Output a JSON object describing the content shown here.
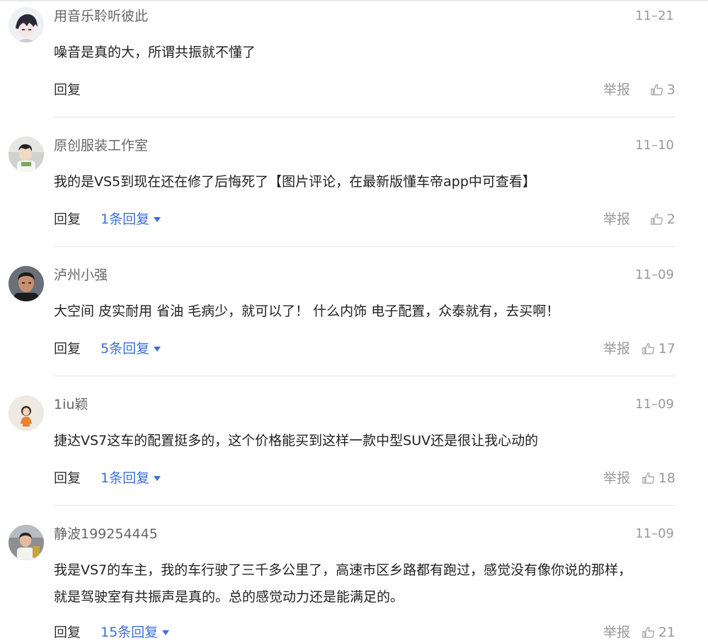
{
  "comments": [
    {
      "username": "用音乐聆听彼此",
      "date": "11–21",
      "content": [
        "噪音是真的大，所谓共振就不懂了"
      ],
      "reply_label": "回复",
      "replies": "",
      "report_label": "举报",
      "likes": "3"
    },
    {
      "username": "原创服装工作室",
      "date": "11–10",
      "content": [
        "我的是VS5到现在还在修了后悔死了【图片评论，在最新版懂车帝app中可查看】"
      ],
      "reply_label": "回复",
      "replies": "1条回复",
      "report_label": "举报",
      "likes": "2"
    },
    {
      "username": "泸州小强",
      "date": "11–09",
      "content": [
        "大空间 皮实耐用 省油 毛病少，就可以了！ 什么内饰 电子配置，众泰就有，去买啊！"
      ],
      "reply_label": "回复",
      "replies": "5条回复",
      "report_label": "举报",
      "likes": "17"
    },
    {
      "username": "1iu颖",
      "date": "11–09",
      "content": [
        "捷达VS7这车的配置挺多的，这个价格能买到这样一款中型SUV还是很让我心动的"
      ],
      "reply_label": "回复",
      "replies": "1条回复",
      "report_label": "举报",
      "likes": "18"
    },
    {
      "username": "静波199254445",
      "date": "11–09",
      "content": [
        "我是VS7的车主，我的车行驶了三千多公里了，高速市区乡路都有跑过，感觉没有像你说的那样，",
        "就是驾驶室有共振声是真的。总的感觉动力还是能满足的。"
      ],
      "reply_label": "回复",
      "replies": "15条回复",
      "report_label": "举报",
      "likes": "21"
    }
  ],
  "colors": {
    "accent": "#3b6fd6",
    "muted": "#999999",
    "text": "#222222",
    "divider": "#e6e6e6"
  },
  "icons": {
    "like": "thumb-up-icon",
    "expand": "caret-down-icon"
  }
}
